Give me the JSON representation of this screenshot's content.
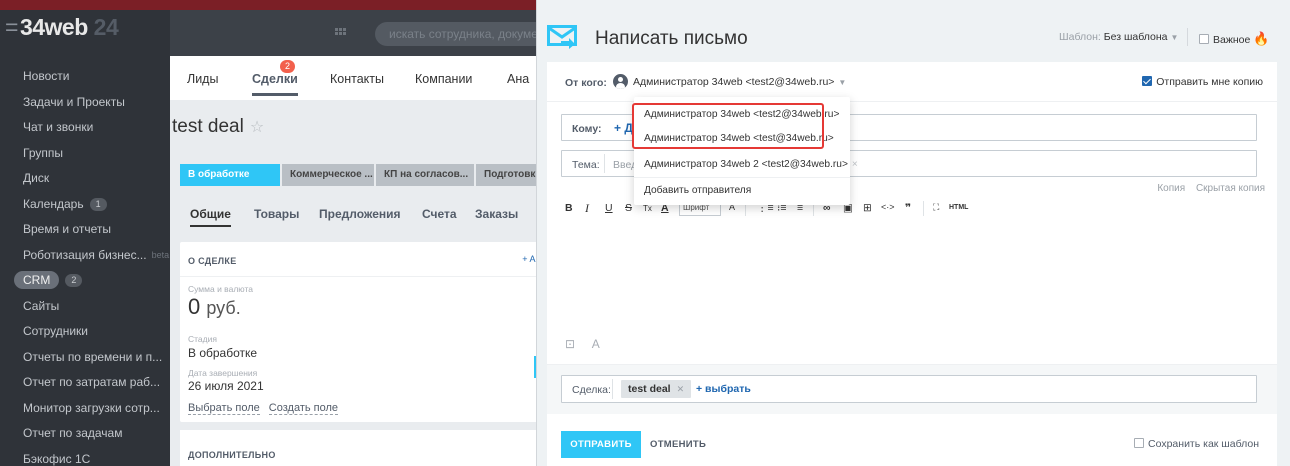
{
  "sidebar": {
    "logo_eq": "=",
    "logo_text": "34web",
    "logo_num": "24",
    "items": [
      {
        "label": "Новости"
      },
      {
        "label": "Задачи и Проекты"
      },
      {
        "label": "Чат и звонки"
      },
      {
        "label": "Группы"
      },
      {
        "label": "Диск"
      },
      {
        "label": "Календарь",
        "count": "1"
      },
      {
        "label": "Время и отчеты"
      },
      {
        "label": "Роботизация бизнес...",
        "beta": "beta"
      },
      {
        "label": "CRM",
        "count": "2"
      },
      {
        "label": "Сайты"
      },
      {
        "label": "Сотрудники"
      },
      {
        "label": "Отчеты по времени и п..."
      },
      {
        "label": "Отчет по затратам раб..."
      },
      {
        "label": "Монитор загрузки сотр..."
      },
      {
        "label": "Отчет по задачам"
      },
      {
        "label": "Бэкофис 1С"
      }
    ]
  },
  "header": {
    "search_placeholder": "искать сотрудника, документ, прочее...",
    "close_glyph": "×"
  },
  "crm": {
    "tabs": [
      "Лиды",
      "Сделки",
      "Контакты",
      "Компании",
      "Ана"
    ],
    "deals_badge": "2",
    "deal_title": "test deal",
    "star_glyph": "☆",
    "stages": [
      "В обработке",
      "Коммерческое ...",
      "КП на согласов...",
      "Подготовк"
    ],
    "sub_tabs": [
      "Общие",
      "Товары",
      "Предложения",
      "Счета",
      "Заказы"
    ],
    "about_header": "О СДЕЛКЕ",
    "about_right": "+ AD",
    "amount_label": "Сумма и валюта",
    "amount_value": "0",
    "amount_currency": "руб.",
    "stage_label": "Стадия",
    "stage_value": "В обработке",
    "close_date_label": "Дата завершения",
    "close_date_value": "26 июля 2021",
    "select_field": "Выбрать поле",
    "create_field": "Создать поле",
    "extra_header": "ДОПОЛНИТЕЛЬНО"
  },
  "mail": {
    "title": "Написать письмо",
    "template_label": "Шаблон:",
    "template_value": "Без шаблона",
    "important": "Важное",
    "from_label": "От кого:",
    "from_value": "Администратор 34web <test2@34web.ru>",
    "copy_me": "Отправить мне копию",
    "to_label": "Кому:",
    "to_add": "+ Д",
    "subject_label": "Тема:",
    "subject_placeholder": "Введ",
    "cc": "Копия",
    "bcc": "Скрытая копия",
    "toolbar": {
      "bold": "B",
      "italic": "I",
      "underline": "U",
      "strike": "S",
      "font": "Шрифт",
      "html": "HTML"
    },
    "bottom_icons": [
      "⊡",
      "A"
    ],
    "binding_label": "Сделка:",
    "binding_chip": "test deal",
    "binding_choose": "+ выбрать",
    "send": "ОТПРАВИТЬ",
    "cancel": "ОТМЕНИТЬ",
    "save_template": "Сохранить как шаблон"
  },
  "dropdown": {
    "items": [
      "Администратор 34web <test2@34web.ru>",
      "Администратор 34web <test@34web.ru>",
      "Администратор 34web 2 <test2@34web.ru>"
    ],
    "add_sender": "Добавить отправителя"
  },
  "colors": {
    "accent": "#2fc6f6",
    "link": "#2067b0",
    "highlight": "#e53935",
    "sidebar_bg": "#2f3339"
  }
}
